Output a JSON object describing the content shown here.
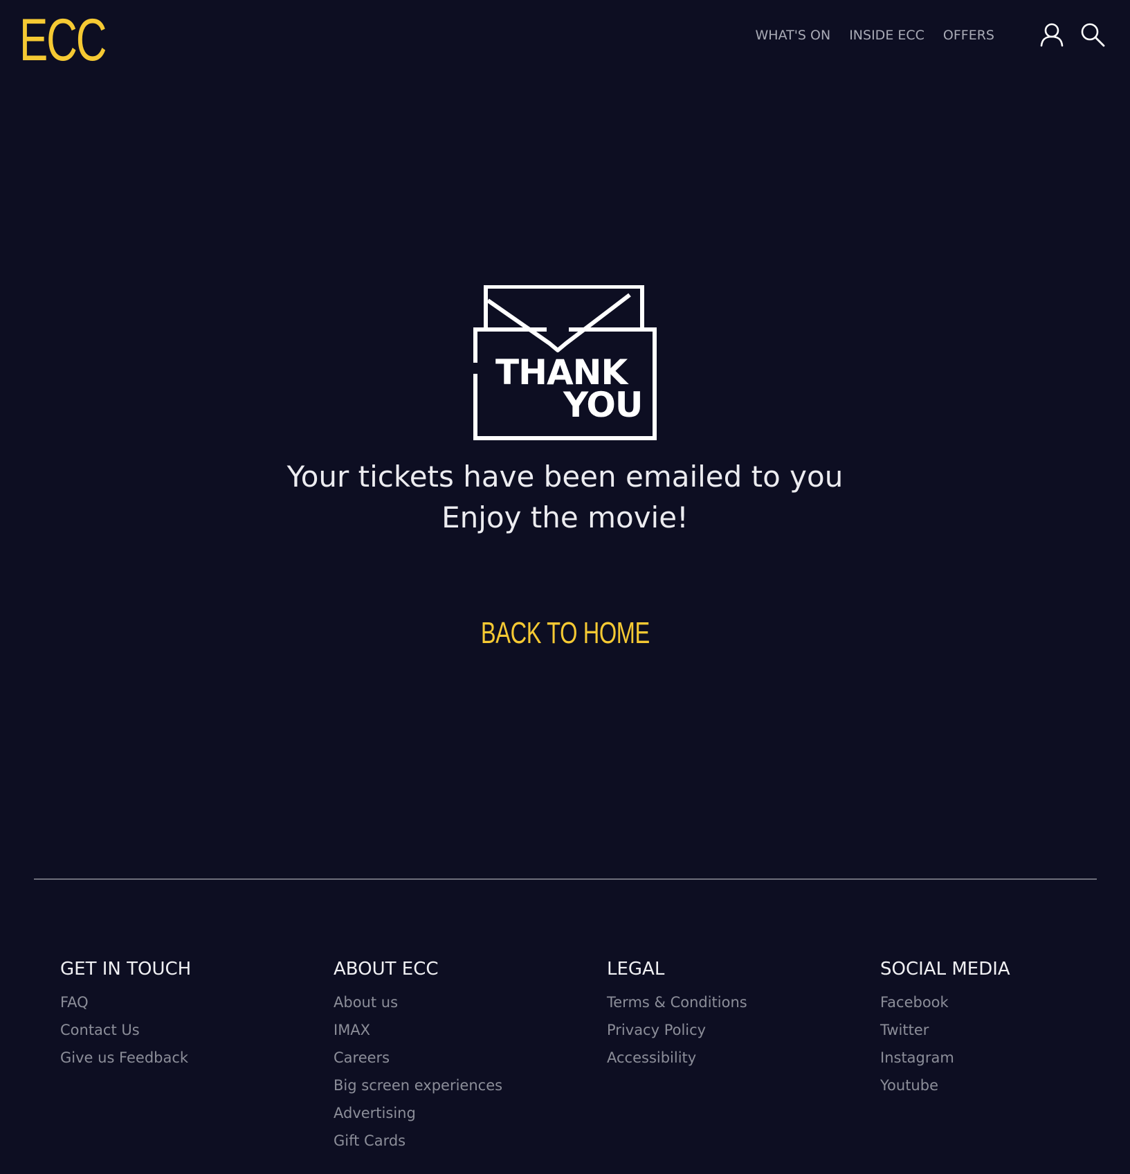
{
  "header": {
    "logo": "ECC",
    "nav": [
      "WHAT'S ON",
      "INSIDE ECC",
      "OFFERS"
    ]
  },
  "icons": {
    "user": "user-icon",
    "search": "search-icon",
    "envelope": "thank-you-envelope-icon"
  },
  "envelope": {
    "line1": "THANK",
    "line2": "YOU"
  },
  "main": {
    "message_line1": "Your tickets have been emailed to you",
    "message_line2": "Enjoy the movie!",
    "back_home": "BACK TO HOME"
  },
  "footer": {
    "columns": [
      {
        "title": "GET IN TOUCH",
        "links": [
          "FAQ",
          "Contact Us",
          "Give us Feedback"
        ]
      },
      {
        "title": "ABOUT ECC",
        "links": [
          "About us",
          "IMAX",
          "Careers",
          "Big screen experiences",
          "Advertising",
          "Gift Cards"
        ]
      },
      {
        "title": "LEGAL",
        "links": [
          "Terms & Conditions",
          "Privacy Policy",
          "Accessibility"
        ]
      },
      {
        "title": "SOCIAL MEDIA",
        "links": [
          "Facebook",
          "Twitter",
          "Instagram",
          "Youtube"
        ]
      }
    ]
  },
  "colors": {
    "background": "#0d0e22",
    "accent": "#f5c933",
    "nav_text": "#a9abb6",
    "footer_link": "#8c8e99"
  }
}
